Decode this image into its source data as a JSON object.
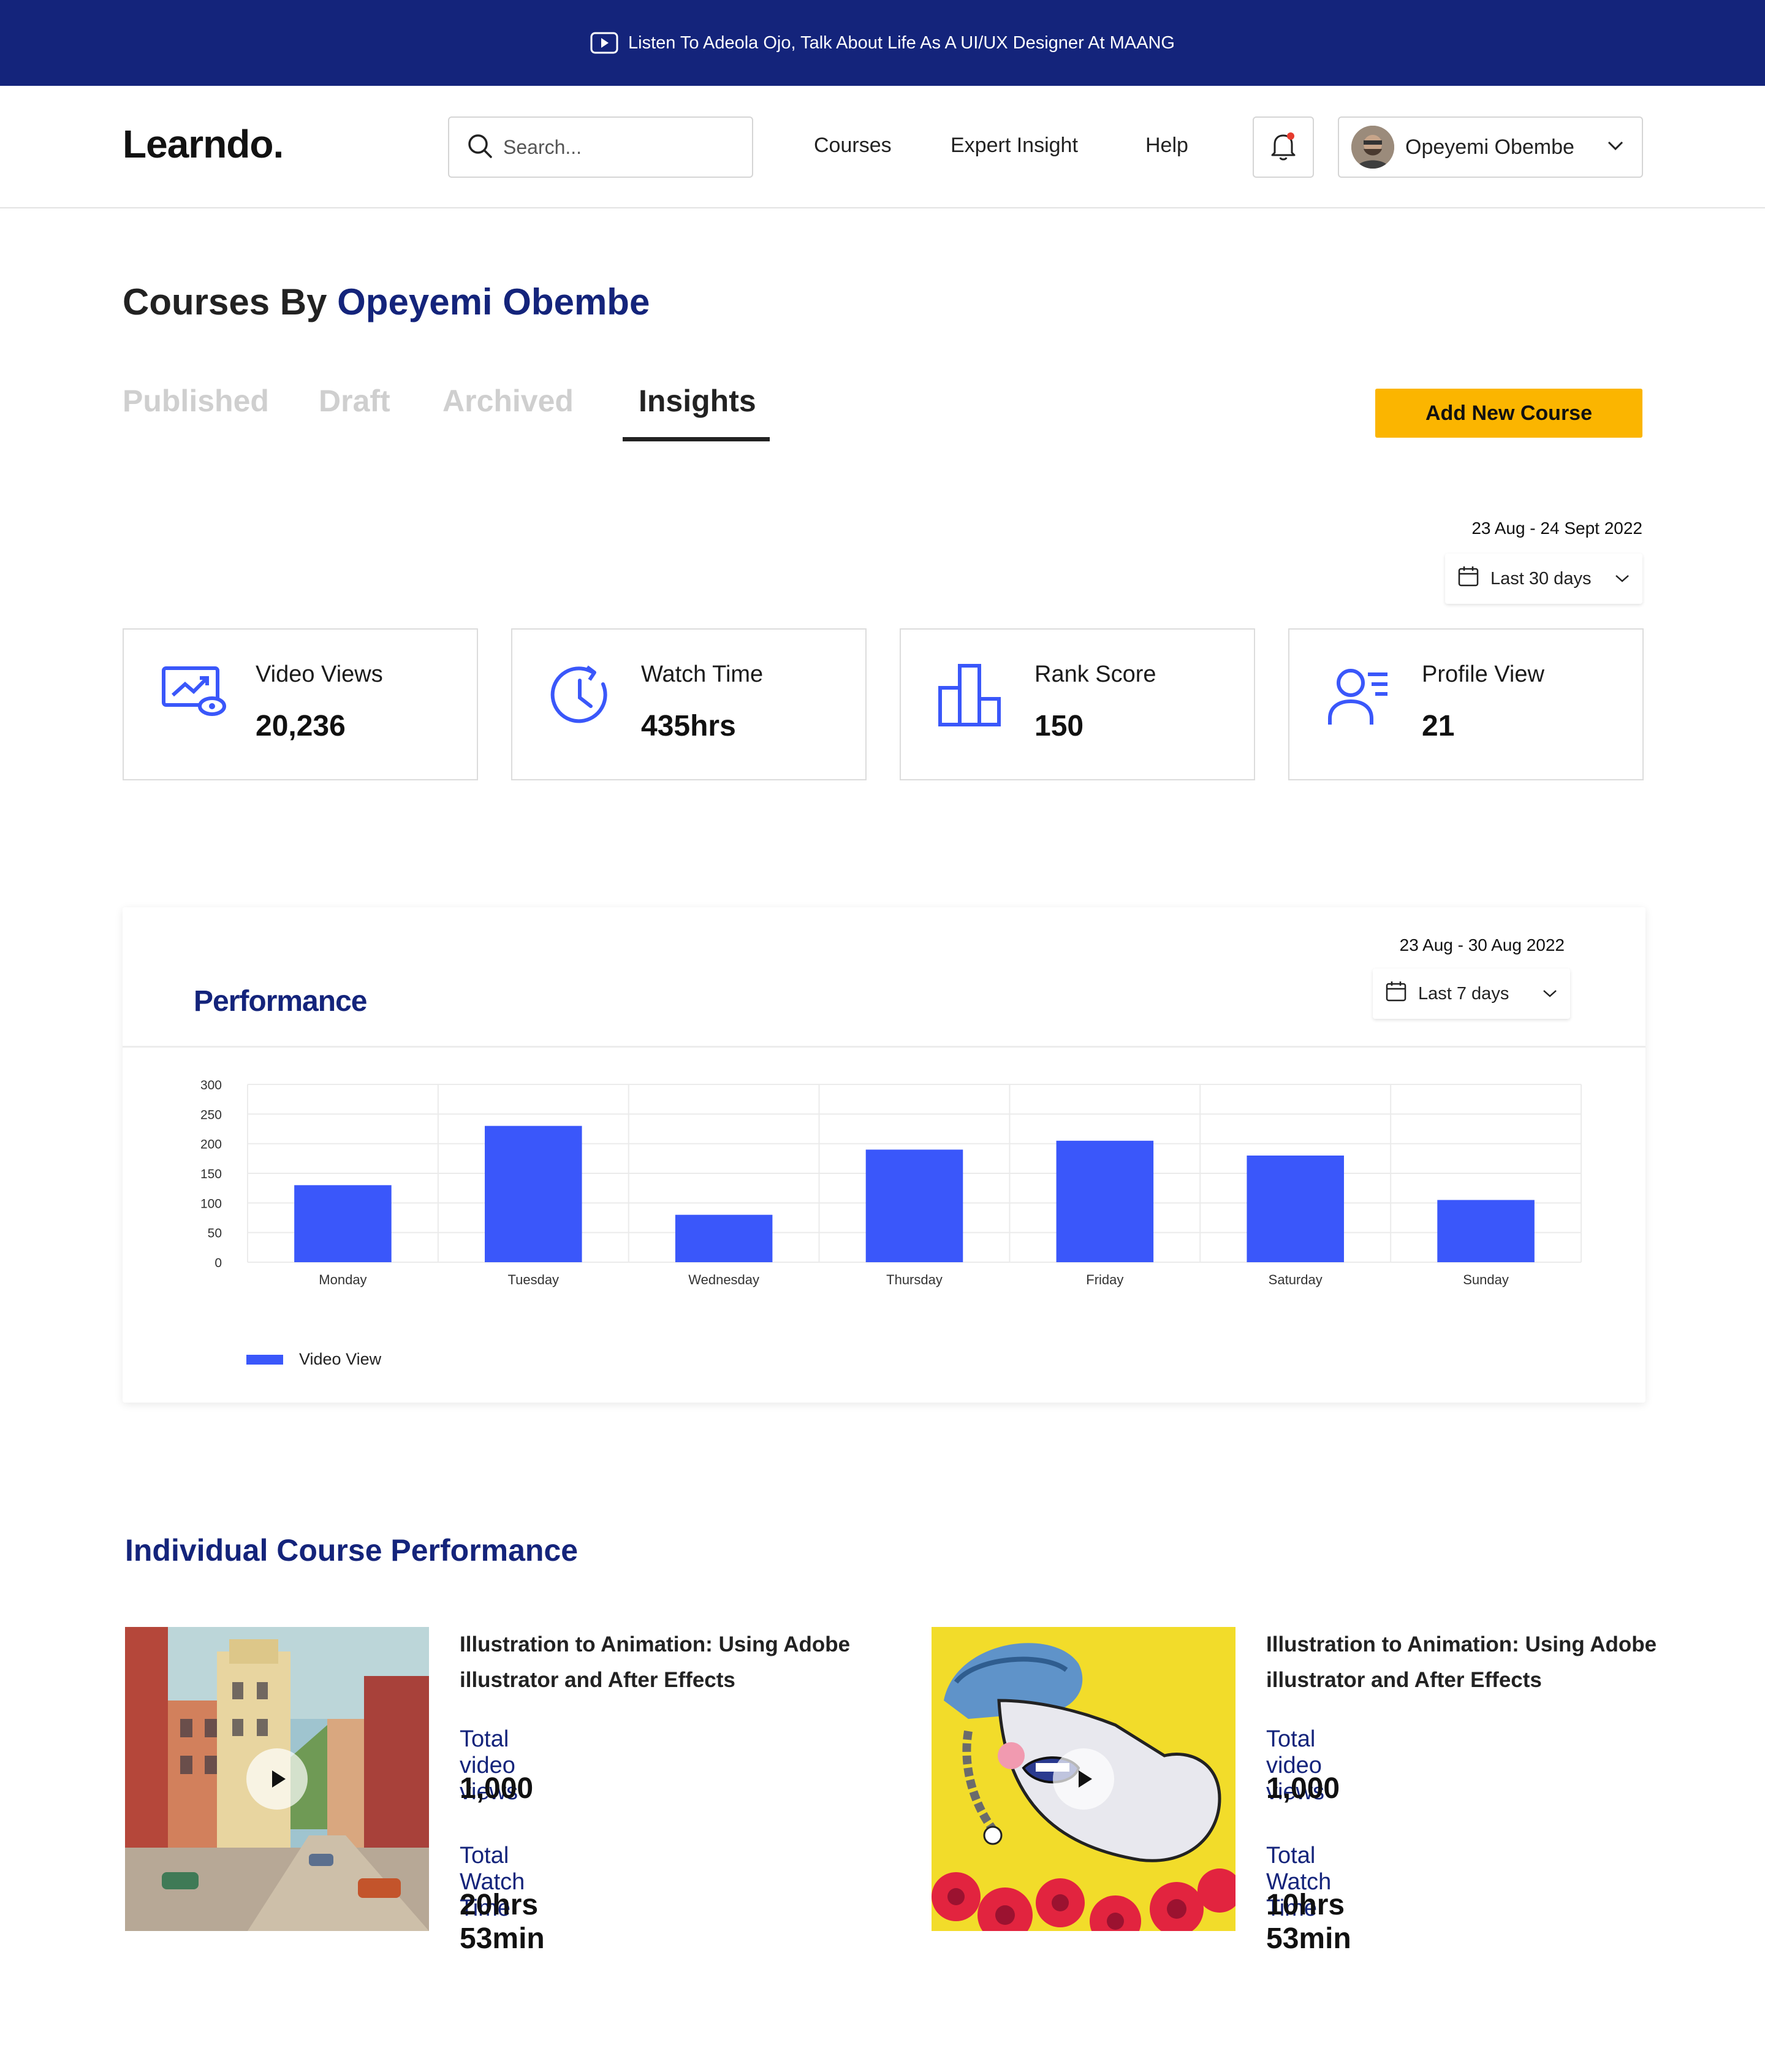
{
  "banner": {
    "text": "Listen To Adeola Ojo, Talk About Life As A UI/UX Designer At MAANG",
    "icon": "youtube-play-icon"
  },
  "header": {
    "logo": "Learndo.",
    "search_placeholder": "Search...",
    "nav": [
      "Courses",
      "Expert Insight",
      "Help"
    ],
    "user_name": "Opeyemi Obembe"
  },
  "page": {
    "title_prefix": "Courses By ",
    "title_name": "Opeyemi Obembe",
    "tabs": [
      "Published",
      "Draft",
      "Archived",
      "Insights"
    ],
    "active_tab": "Insights",
    "add_button": "Add New Course"
  },
  "insights": {
    "date_range": "23 Aug - 24 Sept 2022",
    "period": "Last 30 days",
    "stats": [
      {
        "label": "Video Views",
        "value": "20,236",
        "icon": "video-views-icon"
      },
      {
        "label": "Watch Time",
        "value": "435hrs",
        "icon": "clock-icon"
      },
      {
        "label": "Rank Score",
        "value": "150",
        "icon": "bar-chart-icon"
      },
      {
        "label": "Profile View",
        "value": "21",
        "icon": "profile-list-icon"
      }
    ]
  },
  "performance": {
    "title": "Performance",
    "date_range": "23 Aug - 30 Aug 2022",
    "period": "Last 7 days"
  },
  "chart_data": {
    "type": "bar",
    "categories": [
      "Monday",
      "Tuesday",
      "Wednesday",
      "Thursday",
      "Friday",
      "Saturday",
      "Sunday"
    ],
    "series": [
      {
        "name": "Video View",
        "values": [
          130,
          230,
          80,
          190,
          205,
          180,
          105
        ]
      }
    ],
    "yticks": [
      0,
      50,
      100,
      150,
      200,
      250,
      300
    ],
    "ylim": [
      0,
      300
    ],
    "grid": true,
    "legend": "bottom-left",
    "color": "#3a57fa"
  },
  "courses_section": {
    "title": "Individual Course Performance",
    "courses": [
      {
        "title": "Illustration to Animation: Using Adobe illustrator and After Effects",
        "views_label": "Total video views",
        "views": "1,000",
        "time_label": "Total Watch Time",
        "time": "20hrs 53min"
      },
      {
        "title": "Illustration to Animation: Using Adobe illustrator and After Effects",
        "views_label": "Total video views",
        "views": "1,000",
        "time_label": "Total Watch Time",
        "time": "10hrs 53min"
      }
    ]
  }
}
